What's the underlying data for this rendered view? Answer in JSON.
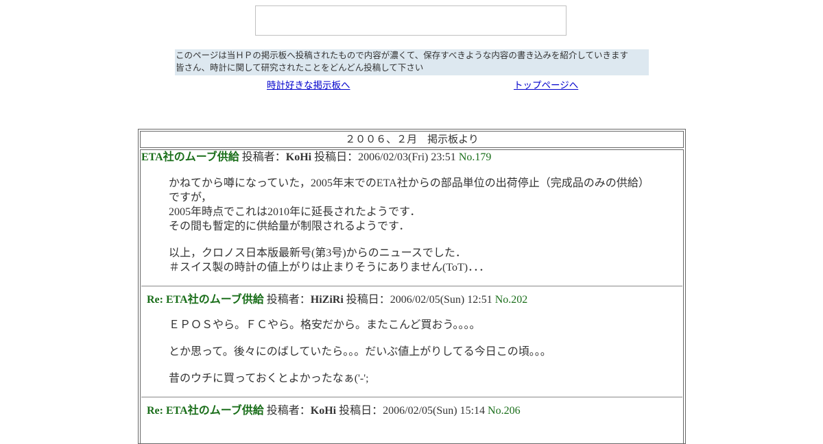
{
  "intro": {
    "line1": "このページは当ＨＰの掲示板へ投稿されたもので内容が濃くて、保存すべきような内容の書き込みを紹介していきます",
    "line2": "皆さん、時計に関して研究されたことをどんどん投稿して下さい"
  },
  "nav": {
    "board_link": "時計好きな掲示板へ",
    "top_link": "トップページへ"
  },
  "caption": "２００６、２月　掲示板より",
  "labels": {
    "poster": "投稿者：",
    "date": "投稿日："
  },
  "posts": [
    {
      "title": "ETA社のムーブ供給",
      "author": "KoHi",
      "date": "2006/02/03(Fri) 23:51",
      "no": "No.179",
      "lines": [
        "かねてから噂になっていた，2005年末でのETA社からの部品単位の出荷停止（完成品のみの供給）",
        "ですが，",
        "2005年時点でこれは2010年に延長されたようです．",
        "その間も暫定的に供給量が制限されるようです．",
        "以上，クロノス日本版最新号(第3号)からのニュースでした．",
        "＃スイス製の時計の値上がりは止まりそうにありません(ToT)．．．"
      ]
    },
    {
      "title": "Re: ETA社のムーブ供給",
      "author": "HiZiRi",
      "date": "2006/02/05(Sun) 12:51",
      "no": "No.202",
      "lines": [
        "ＥＰＯＳやら。ＦＣやら。格安だから。またこんど買おう。。。。",
        "とか思って。後々にのばしていたら。。。だいぶ値上がりしてる今日この頃。。。",
        "昔のウチに買っておくとよかったなぁ('-';"
      ]
    },
    {
      "title": "Re: ETA社のムーブ供給",
      "author": "KoHi",
      "date": "2006/02/05(Sun) 15:14",
      "no": "No.206"
    }
  ]
}
